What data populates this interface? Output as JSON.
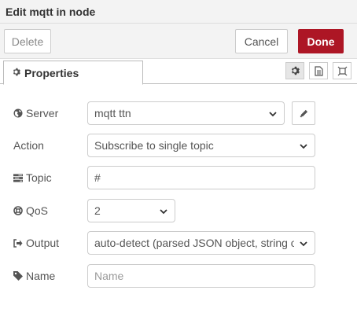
{
  "window": {
    "title": "Edit mqtt in node"
  },
  "actions": {
    "delete_label": "Delete",
    "cancel_label": "Cancel",
    "done_label": "Done"
  },
  "tabs": [
    {
      "label": "Properties",
      "icon": "gear-icon",
      "active": true
    }
  ],
  "tab_tools": [
    "gear-icon",
    "document-icon",
    "frame-icon"
  ],
  "form": {
    "server": {
      "label": "Server",
      "icon": "globe-icon",
      "value": "mqtt ttn"
    },
    "action": {
      "label": "Action",
      "value": "Subscribe to single topic"
    },
    "topic": {
      "label": "Topic",
      "icon": "tasks-icon",
      "value": "#"
    },
    "qos": {
      "label": "QoS",
      "icon": "life-ring-icon",
      "value": "2"
    },
    "output": {
      "label": "Output",
      "icon": "sign-out-icon",
      "value": "auto-detect (parsed JSON object, string or buf"
    },
    "name": {
      "label": "Name",
      "icon": "tag-icon",
      "value": "",
      "placeholder": "Name"
    }
  },
  "colors": {
    "done": "#ad1625",
    "panel_bg": "#f3f3f3"
  }
}
